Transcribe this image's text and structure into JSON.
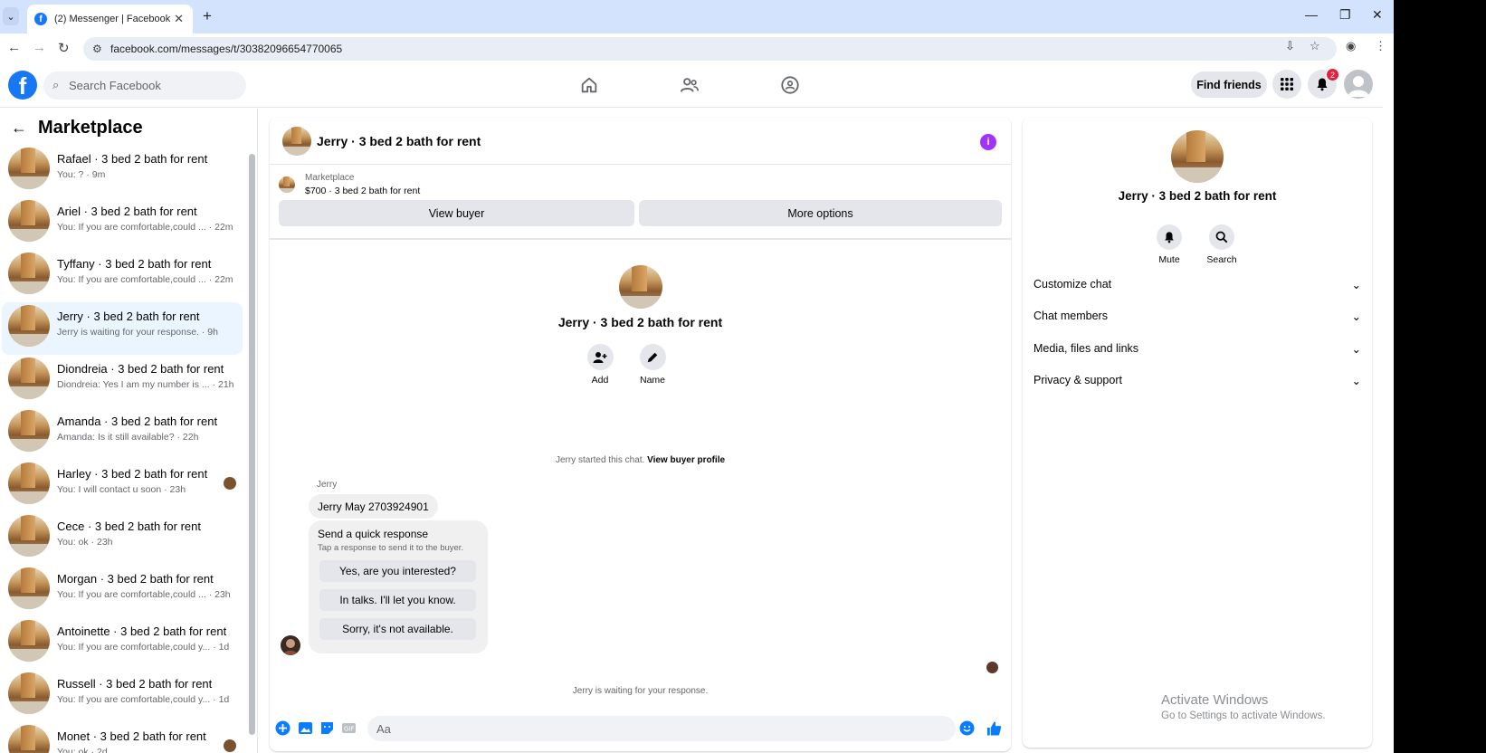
{
  "browser": {
    "tab_title": "(2) Messenger | Facebook",
    "url": "facebook.com/messages/t/30382096654770065"
  },
  "fb": {
    "search_placeholder": "Search Facebook",
    "find_friends": "Find friends",
    "notif_count": "2"
  },
  "sidebar": {
    "title": "Marketplace",
    "items": [
      {
        "name": "Rafael · 3 bed 2 bath for rent",
        "preview": "You: ? · 9m",
        "active": false
      },
      {
        "name": "Ariel · 3 bed 2 bath for rent",
        "preview": "You: If you are comfortable,could ... · 22m",
        "active": false
      },
      {
        "name": "Tyffany · 3 bed 2 bath for rent",
        "preview": "You: If you are comfortable,could ... · 22m",
        "active": false
      },
      {
        "name": "Jerry · 3 bed 2 bath for rent",
        "preview": "Jerry is waiting for your response. · 9h",
        "active": true
      },
      {
        "name": "Diondreia · 3 bed 2 bath for rent",
        "preview": "Diondreia: Yes I am my number is ... · 21h",
        "active": false
      },
      {
        "name": "Amanda · 3 bed 2 bath for rent",
        "preview": "Amanda: Is it still available? · 22h",
        "active": false
      },
      {
        "name": "Harley · 3 bed 2 bath for rent",
        "preview": "You: I will contact u soon · 23h",
        "active": false
      },
      {
        "name": "Cece · 3 bed 2 bath for rent",
        "preview": "You: ok · 23h",
        "active": false
      },
      {
        "name": "Morgan · 3 bed 2 bath for rent",
        "preview": "You: If you are comfortable,could ... · 23h",
        "active": false
      },
      {
        "name": "Antoinette · 3 bed 2 bath for rent",
        "preview": "You: If you are comfortable,could y... · 1d",
        "active": false
      },
      {
        "name": "Russell · 3 bed 2 bath for rent",
        "preview": "You: If you are comfortable,could y... · 1d",
        "active": false
      },
      {
        "name": "Monet · 3 bed 2 bath for rent",
        "preview": "You: ok · 2d",
        "active": false
      }
    ]
  },
  "chat": {
    "title": "Jerry · 3 bed 2 bath for rent",
    "listing_category": "Marketplace",
    "listing_price": "$700 · 3 bed 2 bath for rent",
    "view_buyer": "View buyer",
    "more_options": "More options",
    "profile_name": "Jerry · 3 bed 2 bath for rent",
    "add_label": "Add",
    "name_label": "Name",
    "started_text": "Jerry started this chat.",
    "view_buyer_profile": "View buyer profile",
    "sender": "Jerry",
    "message": "Jerry May 2703924901",
    "quick_title": "Send a quick response",
    "quick_subtitle": "Tap a response to send it to the buyer.",
    "quick_responses": [
      "Yes, are you interested?",
      "In talks. I'll let you know.",
      "Sorry, it's not available."
    ],
    "waiting": "Jerry is waiting for your response.",
    "composer_placeholder": "Aa"
  },
  "details": {
    "name": "Jerry · 3 bed 2 bath for rent",
    "mute": "Mute",
    "search": "Search",
    "sections": [
      "Customize chat",
      "Chat members",
      "Media, files and links",
      "Privacy & support"
    ]
  },
  "watermark": {
    "line1": "Activate Windows",
    "line2": "Go to Settings to activate Windows."
  },
  "colors": {
    "fb_blue": "#1877f2",
    "active_row": "#ebf5ff",
    "info_purple": "#a033ff",
    "badge_red": "#e41e3f"
  }
}
